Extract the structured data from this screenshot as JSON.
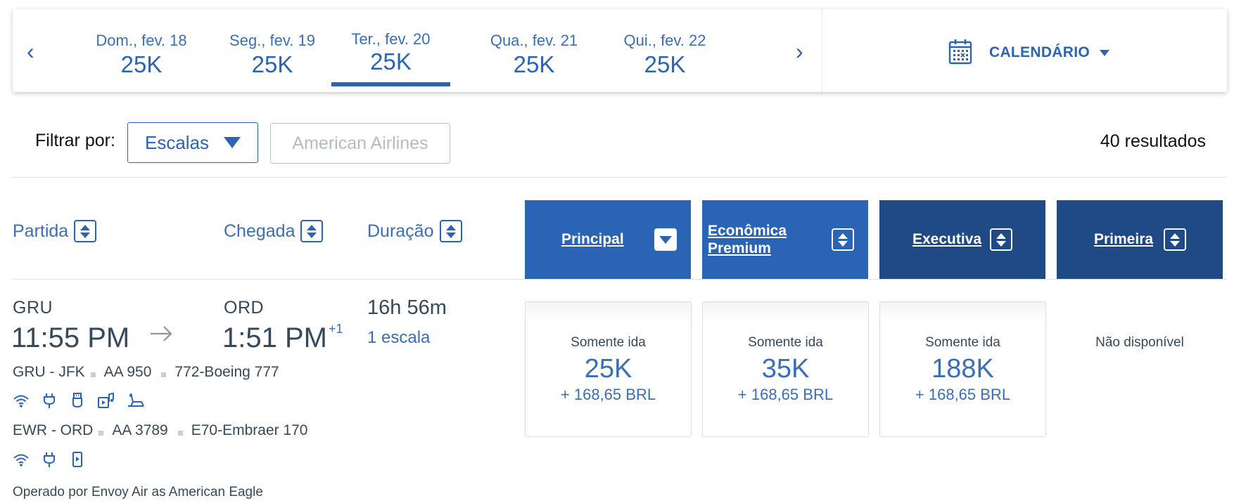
{
  "date_nav": {
    "prev_glyph": "‹",
    "next_glyph": "›",
    "days": [
      {
        "label": "Dom., fev. 18",
        "price": "25K"
      },
      {
        "label": "Seg., fev. 19",
        "price": "25K"
      },
      {
        "label": "Ter., fev. 20",
        "price": "25K",
        "selected": true
      },
      {
        "label": "Qua., fev. 21",
        "price": "25K"
      },
      {
        "label": "Qui., fev. 22",
        "price": "25K"
      }
    ],
    "calendar_label": "CALENDÁRIO",
    "calendar_icon": "calendar-icon"
  },
  "filters": {
    "label": "Filtrar por:",
    "stops_select": "Escalas",
    "airline_button": "American Airlines",
    "results_count": "40 resultados"
  },
  "columns": {
    "departure": "Partida",
    "arrival": "Chegada",
    "duration": "Duração",
    "cabins": [
      {
        "label": "Principal",
        "color": "#2b64b4",
        "icon": "dropdown-icon"
      },
      {
        "label_line1": "Econômica",
        "label_line2": "Premium",
        "color": "#2b64b4",
        "icon": "sort-icon"
      },
      {
        "label": "Executiva",
        "color": "#1f4a86",
        "icon": "sort-icon"
      },
      {
        "label": "Primeira",
        "color": "#1f4a86",
        "icon": "sort-icon"
      }
    ]
  },
  "flight": {
    "origin": "GRU",
    "depart_time": "11:55 PM",
    "destination": "ORD",
    "arrive_time": "1:51 PM",
    "day_offset": "+1",
    "duration": "16h 56m",
    "stops": "1 escala",
    "segments": [
      {
        "route": "GRU - JFK",
        "flight": "AA 950",
        "aircraft": "772-Boeing 777",
        "amenities": [
          "wifi-icon",
          "power-outlet-icon",
          "usb-icon",
          "entertainment-icon",
          "lie-flat-seat-icon"
        ]
      },
      {
        "route": "EWR - ORD",
        "flight": "AA 3789",
        "aircraft": "E70-Embraer 170",
        "amenities": [
          "wifi-icon",
          "power-outlet-icon",
          "device-entertainment-icon"
        ]
      }
    ],
    "operated_by": "Operado por Envoy Air as American Eagle",
    "fares": [
      {
        "type": "Somente ida",
        "miles": "25K",
        "tax": "+ 168,65 BRL"
      },
      {
        "type": "Somente ida",
        "miles": "35K",
        "tax": "+ 168,65 BRL"
      },
      {
        "type": "Somente ida",
        "miles": "188K",
        "tax": "+ 168,65 BRL"
      }
    ],
    "first_unavailable": "Não disponível"
  },
  "colors": {
    "accent": "#2b64b4",
    "dark_header": "#1f4a86",
    "text": "#36495a"
  }
}
